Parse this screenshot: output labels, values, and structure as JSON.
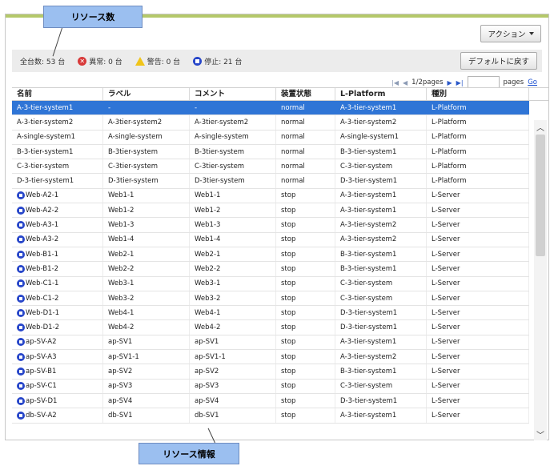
{
  "callouts": {
    "top": "リソース数",
    "bottom": "リソース情報"
  },
  "toolbar": {
    "action_label": "アクション",
    "default_label": "デフォルトに戻す"
  },
  "status": {
    "total": "全台数: 53 台",
    "error": "異常: 0 台",
    "warning": "警告: 0 台",
    "stopped": "停止: 21 台"
  },
  "pager": {
    "page_info": "1/2pages",
    "pages_label": "pages",
    "go_label": "Go"
  },
  "table": {
    "headers": [
      "名前",
      "ラベル",
      "コメント",
      "装置状態",
      "L-Platform",
      "種別"
    ],
    "rows": [
      {
        "name": "A-3-tier-system1",
        "label": "-",
        "comment": "-",
        "status": "normal",
        "platform": "A-3-tier-system1",
        "type": "L-Platform",
        "icon": ""
      },
      {
        "name": "A-3-tier-system2",
        "label": "A-3tier-system2",
        "comment": "A-3tier-system2",
        "status": "normal",
        "platform": "A-3-tier-system2",
        "type": "L-Platform",
        "icon": ""
      },
      {
        "name": "A-single-system1",
        "label": "A-single-system",
        "comment": "A-single-system",
        "status": "normal",
        "platform": "A-single-system1",
        "type": "L-Platform",
        "icon": ""
      },
      {
        "name": "B-3-tier-system1",
        "label": "B-3tier-system",
        "comment": "B-3tier-system",
        "status": "normal",
        "platform": "B-3-tier-system1",
        "type": "L-Platform",
        "icon": ""
      },
      {
        "name": "C-3-tier-system",
        "label": "C-3tier-system",
        "comment": "C-3tier-system",
        "status": "normal",
        "platform": "C-3-tier-system",
        "type": "L-Platform",
        "icon": ""
      },
      {
        "name": "D-3-tier-system1",
        "label": "D-3tier-system",
        "comment": "D-3tier-system",
        "status": "normal",
        "platform": "D-3-tier-system1",
        "type": "L-Platform",
        "icon": ""
      },
      {
        "name": "Web-A2-1",
        "label": "Web1-1",
        "comment": "Web1-1",
        "status": "stop",
        "platform": "A-3-tier-system1",
        "type": "L-Server",
        "icon": "stop-icon"
      },
      {
        "name": "Web-A2-2",
        "label": "Web1-2",
        "comment": "Web1-2",
        "status": "stop",
        "platform": "A-3-tier-system1",
        "type": "L-Server",
        "icon": "stop-icon"
      },
      {
        "name": "Web-A3-1",
        "label": "Web1-3",
        "comment": "Web1-3",
        "status": "stop",
        "platform": "A-3-tier-system2",
        "type": "L-Server",
        "icon": "stop-icon"
      },
      {
        "name": "Web-A3-2",
        "label": "Web1-4",
        "comment": "Web1-4",
        "status": "stop",
        "platform": "A-3-tier-system2",
        "type": "L-Server",
        "icon": "stop-icon"
      },
      {
        "name": "Web-B1-1",
        "label": "Web2-1",
        "comment": "Web2-1",
        "status": "stop",
        "platform": "B-3-tier-system1",
        "type": "L-Server",
        "icon": "stop-icon"
      },
      {
        "name": "Web-B1-2",
        "label": "Web2-2",
        "comment": "Web2-2",
        "status": "stop",
        "platform": "B-3-tier-system1",
        "type": "L-Server",
        "icon": "stop-icon"
      },
      {
        "name": "Web-C1-1",
        "label": "Web3-1",
        "comment": "Web3-1",
        "status": "stop",
        "platform": "C-3-tier-system",
        "type": "L-Server",
        "icon": "stop-icon"
      },
      {
        "name": "Web-C1-2",
        "label": "Web3-2",
        "comment": "Web3-2",
        "status": "stop",
        "platform": "C-3-tier-system",
        "type": "L-Server",
        "icon": "stop-icon"
      },
      {
        "name": "Web-D1-1",
        "label": "Web4-1",
        "comment": "Web4-1",
        "status": "stop",
        "platform": "D-3-tier-system1",
        "type": "L-Server",
        "icon": "stop-icon"
      },
      {
        "name": "Web-D1-2",
        "label": "Web4-2",
        "comment": "Web4-2",
        "status": "stop",
        "platform": "D-3-tier-system1",
        "type": "L-Server",
        "icon": "stop-icon"
      },
      {
        "name": "ap-SV-A2",
        "label": "ap-SV1",
        "comment": "ap-SV1",
        "status": "stop",
        "platform": "A-3-tier-system1",
        "type": "L-Server",
        "icon": "stop-icon"
      },
      {
        "name": "ap-SV-A3",
        "label": "ap-SV1-1",
        "comment": "ap-SV1-1",
        "status": "stop",
        "platform": "A-3-tier-system2",
        "type": "L-Server",
        "icon": "stop-icon"
      },
      {
        "name": "ap-SV-B1",
        "label": "ap-SV2",
        "comment": "ap-SV2",
        "status": "stop",
        "platform": "B-3-tier-system1",
        "type": "L-Server",
        "icon": "stop-icon"
      },
      {
        "name": "ap-SV-C1",
        "label": "ap-SV3",
        "comment": "ap-SV3",
        "status": "stop",
        "platform": "C-3-tier-system",
        "type": "L-Server",
        "icon": "stop-icon"
      },
      {
        "name": "ap-SV-D1",
        "label": "ap-SV4",
        "comment": "ap-SV4",
        "status": "stop",
        "platform": "D-3-tier-system1",
        "type": "L-Server",
        "icon": "stop-icon"
      },
      {
        "name": "db-SV-A2",
        "label": "db-SV1",
        "comment": "db-SV1",
        "status": "stop",
        "platform": "A-3-tier-system1",
        "type": "L-Server",
        "icon": "stop-icon"
      }
    ]
  },
  "colors": {
    "selected_row": "#2f75d6",
    "callout_bg": "#9bbff0",
    "accent_bar": "#b4c86a"
  }
}
